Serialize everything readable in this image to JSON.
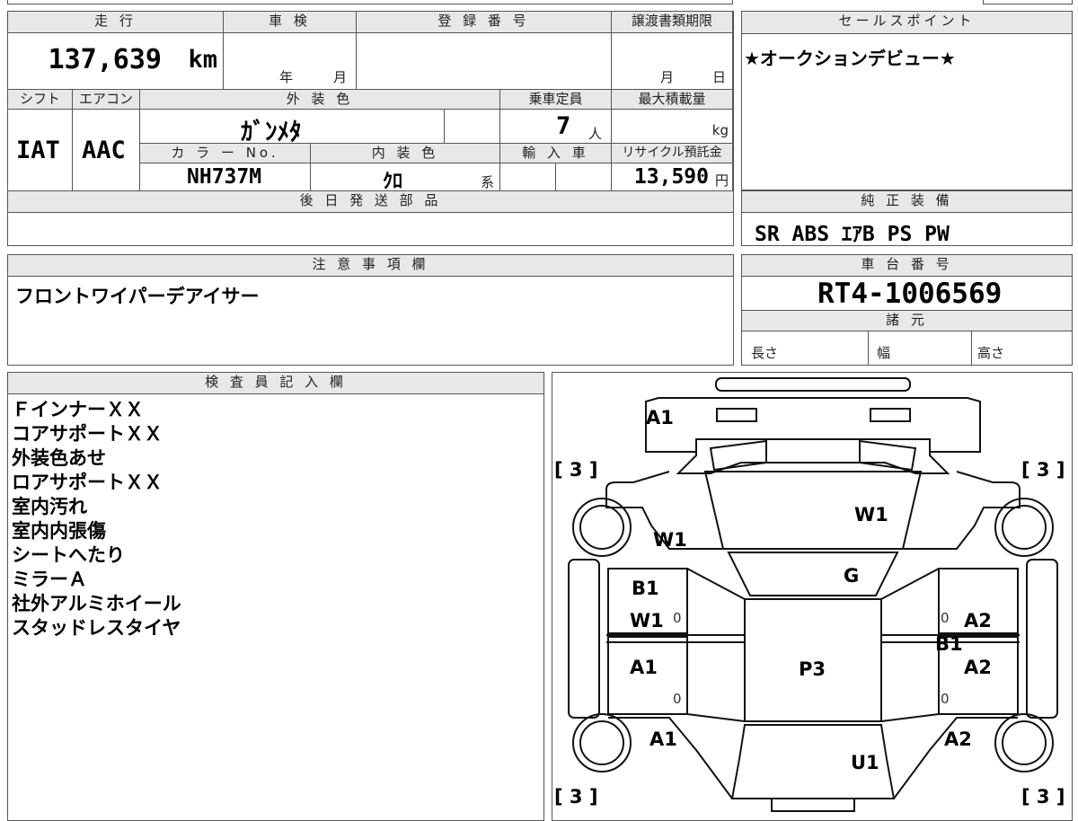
{
  "main": {
    "mileage_header": "走 行",
    "mileage_value": "137,639",
    "mileage_unit": "km",
    "shaken_header": "車 検",
    "shaken_year": "年",
    "shaken_month": "月",
    "reg_header": "登 録 番 号",
    "doc_header": "譲渡書類期限",
    "doc_month": "月",
    "doc_day": "日",
    "shift_header": "シフト",
    "shift_value": "IAT",
    "ac_header": "エアコン",
    "ac_value": "AAC",
    "ext_color_header": "外 装 色",
    "ext_color_value": "ｶﾞﾝﾒﾀ",
    "capacity_header": "乗車定員",
    "capacity_value": "7",
    "capacity_unit": "人",
    "maxload_header": "最大積載量",
    "maxload_unit": "kg",
    "color_no_header": "カ ラ ー No.",
    "color_no_value": "NH737M",
    "int_color_header": "内 装 色",
    "int_color_value": "ｸﾛ",
    "int_color_suffix": "系",
    "import_header": "輸 入 車",
    "recycle_header": "リサイクル預託金",
    "recycle_value": "13,590",
    "recycle_unit": "円",
    "later_parts_header": "後 日 発 送 部 品"
  },
  "sales": {
    "header": "セールスポイント",
    "text": "★オークションデビュー★"
  },
  "equipment": {
    "header": "純 正 装 備",
    "items": "SR ABS ｴｱB PS PW"
  },
  "notes": {
    "header": "注 意 事 項 欄",
    "text": "フロントワイパーデアイサー"
  },
  "chassis": {
    "header": "車 台 番 号",
    "number": "RT4-1006569",
    "spec_header": "諸 元",
    "length_label": "長さ",
    "width_label": "幅",
    "height_label": "高さ"
  },
  "inspector": {
    "header": "検 査 員 記 入 欄",
    "lines": [
      "ＦインナーＸＸ",
      "コアサポートＸＸ",
      "外装色あせ",
      "ロアサポートＸＸ",
      "室内汚れ",
      "室内内張傷",
      "シートへたり",
      "ミラーＡ",
      "社外アルミホイール",
      "スタッドレスタイヤ"
    ]
  },
  "diagram": {
    "tire_left_front": "[ 3 ]",
    "tire_right_front": "[ 3 ]",
    "tire_left_rear": "[ 3 ]",
    "tire_right_rear": "[ 3 ]",
    "marks": {
      "front_bumper": "A1",
      "hood": "W1",
      "left_front_fender": "W1",
      "windshield": "G",
      "left_front_door_1": "B1",
      "left_front_door_2": "W1",
      "left_front_door_0": "0",
      "right_front_door_0": "0",
      "right_front_door": "A2",
      "right_sill": "B1",
      "left_rear_door": "A1",
      "left_rear_door_0": "0",
      "roof": "P3",
      "right_rear_door": "A2",
      "right_rear_door_0": "0",
      "left_rear_fender": "A1",
      "right_rear_fender": "A2",
      "rear_gate": "U1"
    }
  }
}
